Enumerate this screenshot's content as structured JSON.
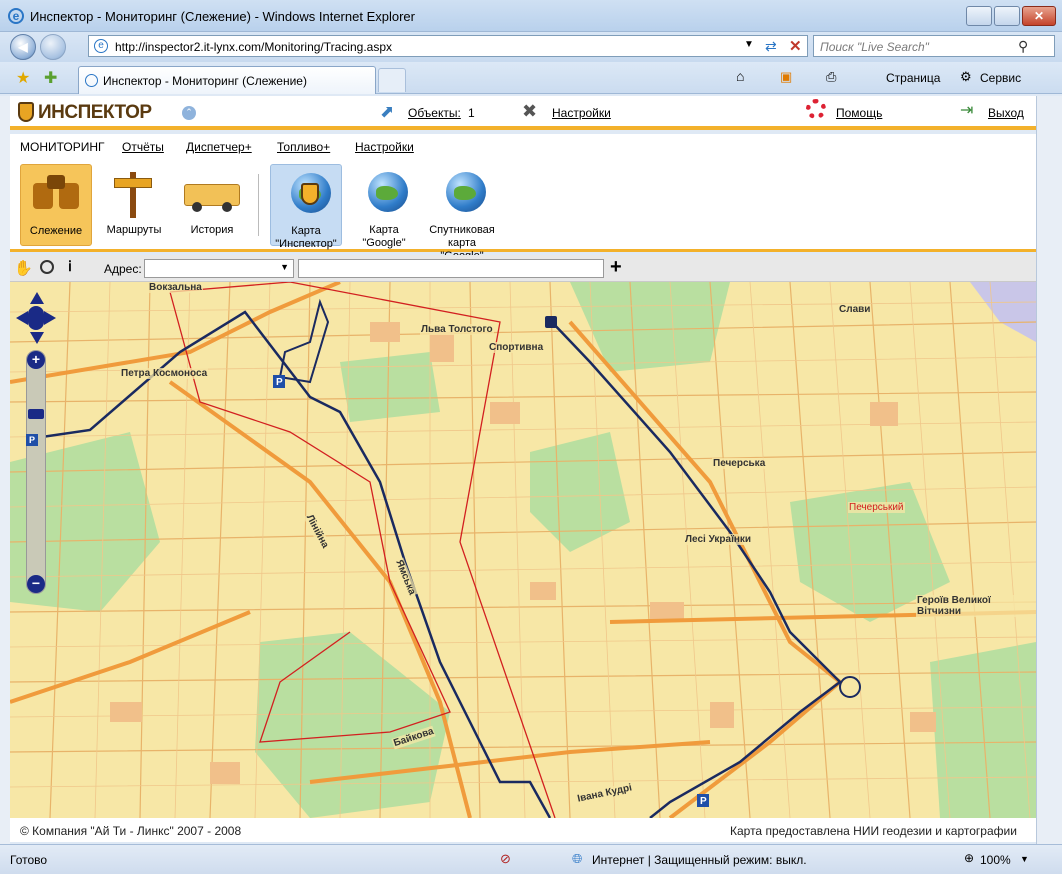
{
  "window": {
    "title": "Инспектор - Мониторинг (Слежение) - Windows Internet Explorer"
  },
  "browser": {
    "url": "http://inspector2.it-lynx.com/Monitoring/Tracing.aspx",
    "search_placeholder": "Поиск \"Live Search\"",
    "tab_title": "Инспектор - Мониторинг (Слежение)",
    "page_menu": "Страница",
    "tools_menu": "Сервис"
  },
  "app": {
    "logo": "ИНСПЕКТОР",
    "objects_label": "Объекты:",
    "objects_count": "1",
    "settings_label": "Настройки",
    "help_label": "Помощь",
    "exit_label": "Выход",
    "brand_color": "#f3b12b"
  },
  "menu": {
    "active": "МОНИТОРИНГ",
    "items": [
      "Отчёты",
      "Диспетчер+",
      "Топливо+",
      "Настройки"
    ]
  },
  "tools": [
    {
      "label": "Слежение",
      "icon": "binoculars-icon"
    },
    {
      "label": "Маршруты",
      "icon": "signpost-icon"
    },
    {
      "label": "История",
      "icon": "truck-icon"
    },
    {
      "label": "Карта \"Инспектор\"",
      "icon": "shield-globe-icon"
    },
    {
      "label": "Карта \"Google\"",
      "icon": "globe-icon"
    },
    {
      "label": "Спутниковая карта \"Google\"",
      "icon": "globe-icon"
    }
  ],
  "address_tool": {
    "label": "Адрес:",
    "add": "+"
  },
  "map_labels": [
    "Вокзальна",
    "Льва Толстого",
    "Спортивна",
    "Слави",
    "Петра Космоноса",
    "Печерська",
    "Печерський",
    "Лесі Українки",
    "Лінійна",
    "Ямська",
    "Героїв Великої Вітчизни",
    "Байкова",
    "Івана Кудрі"
  ],
  "footer": {
    "copyright": "© Компания \"Ай Ти - Линкс\" 2007 - 2008",
    "credit": "Карта предоставлена НИИ геодезии и картографии"
  },
  "status": {
    "ready": "Готово",
    "zone": "Интернет | Защищенный режим: выкл.",
    "zoom": "100%"
  }
}
